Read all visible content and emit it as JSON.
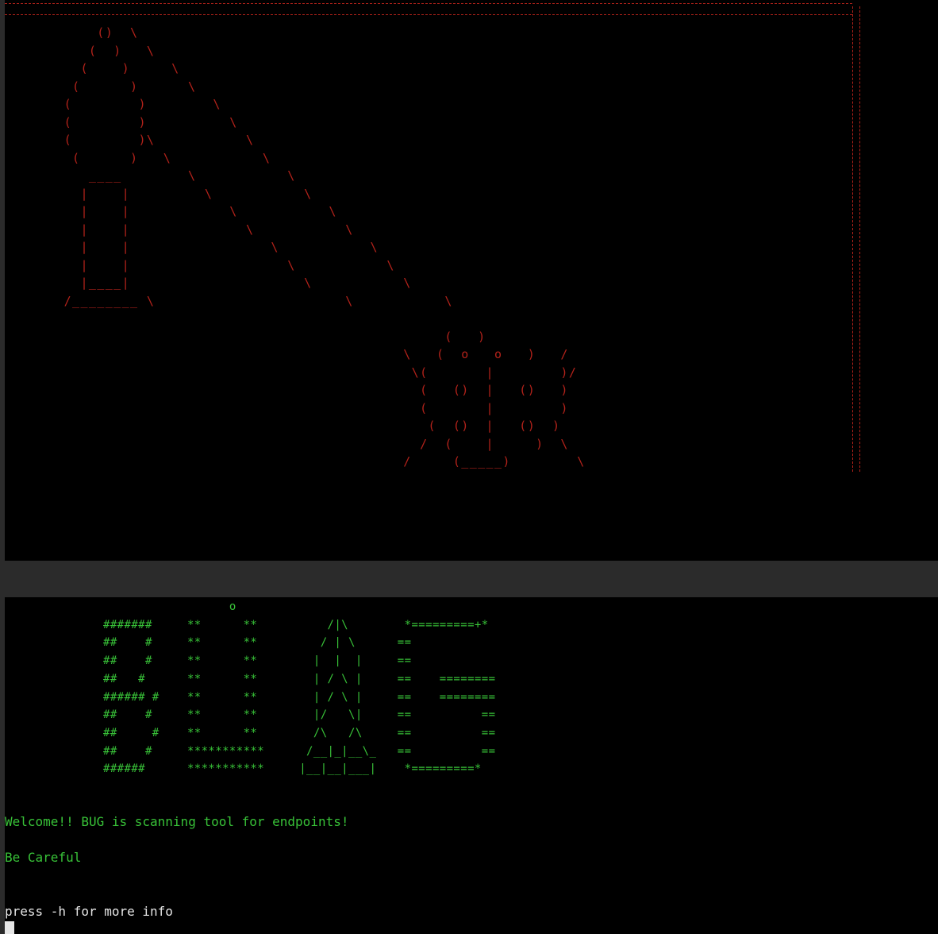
{
  "terminal": {
    "top_art_lines": [
      "          ()  \\",
      "         (  )   \\",
      "        (    )     \\",
      "       (      )      \\",
      "      (        )        \\",
      "      (        )          \\",
      "      (        )\\           \\",
      "       (      )   \\           \\",
      "         ____        \\           \\",
      "        |    |         \\           \\",
      "        |    |            \\           \\",
      "        |    |              \\           \\",
      "        |    |                 \\           \\",
      "        |    |                   \\           \\",
      "        |____|                     \\           \\",
      "      /________ \\                       \\           \\",
      "",
      "                                                    (   )",
      "                                               \\   (  o   o   )   /",
      "                                                \\(       |        )/",
      "                                                 (   ()  |   ()   )",
      "                                                 (       |        )",
      "                                                  (  ()  |   ()  )",
      "                                                 /  (    |     )  \\",
      "                                               /     (_____)        \\"
    ],
    "banner_lines": [
      "                  o",
      "#######     **      **          /|\\        *=========+*",
      "##    #     **      **         / | \\      ==",
      "##    #     **      **        |  |  |     ==",
      "##   #      **      **        | / \\ |     ==    ========",
      "###### #    **      **        | / \\ |     ==    ========",
      "##    #     **      **        |/   \\|     ==          ==",
      "##     #    **      **        /\\   /\\     ==          ==",
      "##    #     ***********      /__|_|__\\_   ==          ==",
      "######      ***********     |__|__|___|    *=========*"
    ],
    "welcome": "Welcome!! BUG is scanning tool for endpoints!",
    "warning": "Be Careful",
    "hint": "press -h for more info"
  },
  "colors": {
    "background": "#000000",
    "art_red": "#b3221a",
    "art_green": "#38c238",
    "text": "#e6e6e6",
    "divider": "#2b2b2b"
  }
}
